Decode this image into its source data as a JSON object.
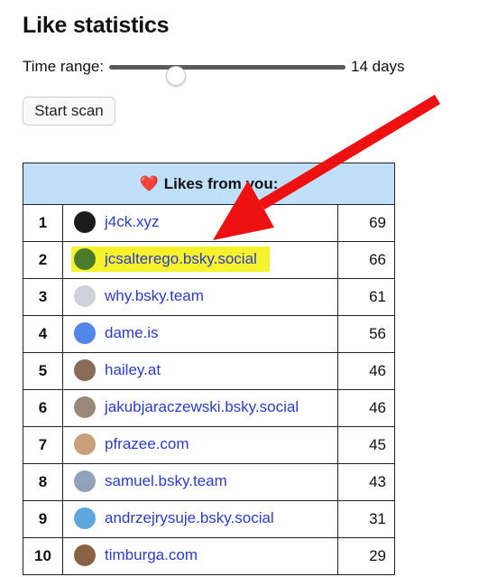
{
  "page": {
    "title": "Like statistics"
  },
  "controls": {
    "time_range_label": "Time range:",
    "time_range_value": "14 days",
    "slider_fraction": 0.24,
    "scan_button_label": "Start scan"
  },
  "table": {
    "header_icon": "heart-icon",
    "header_title": "Likes from you:",
    "rows": [
      {
        "rank": "1",
        "handle": "j4ck.xyz",
        "count": "69",
        "avatar_color": "#1c1c1c",
        "highlight": false
      },
      {
        "rank": "2",
        "handle": "jcsalterego.bsky.social",
        "count": "66",
        "avatar_color": "#4a7a2a",
        "highlight": true
      },
      {
        "rank": "3",
        "handle": "why.bsky.team",
        "count": "61",
        "avatar_color": "#cfd2da",
        "highlight": false
      },
      {
        "rank": "4",
        "handle": "dame.is",
        "count": "56",
        "avatar_color": "#4f86e8",
        "highlight": false
      },
      {
        "rank": "5",
        "handle": "hailey.at",
        "count": "46",
        "avatar_color": "#8a6a58",
        "highlight": false
      },
      {
        "rank": "6",
        "handle": "jakubjaraczewski.bsky.social",
        "count": "46",
        "avatar_color": "#9a8878",
        "highlight": false
      },
      {
        "rank": "7",
        "handle": "pfrazee.com",
        "count": "45",
        "avatar_color": "#c9a07a",
        "highlight": false
      },
      {
        "rank": "8",
        "handle": "samuel.bsky.team",
        "count": "43",
        "avatar_color": "#8fa2b8",
        "highlight": false
      },
      {
        "rank": "9",
        "handle": "andrzejrysuje.bsky.social",
        "count": "31",
        "avatar_color": "#5fa6dc",
        "highlight": false
      },
      {
        "rank": "10",
        "handle": "timburga.com",
        "count": "29",
        "avatar_color": "#8a6242",
        "highlight": false
      }
    ]
  },
  "colors": {
    "header_background": "#bfe0f8",
    "link": "#2a3bd4",
    "highlight": "#f6f22c",
    "arrow": "#ee1111"
  }
}
